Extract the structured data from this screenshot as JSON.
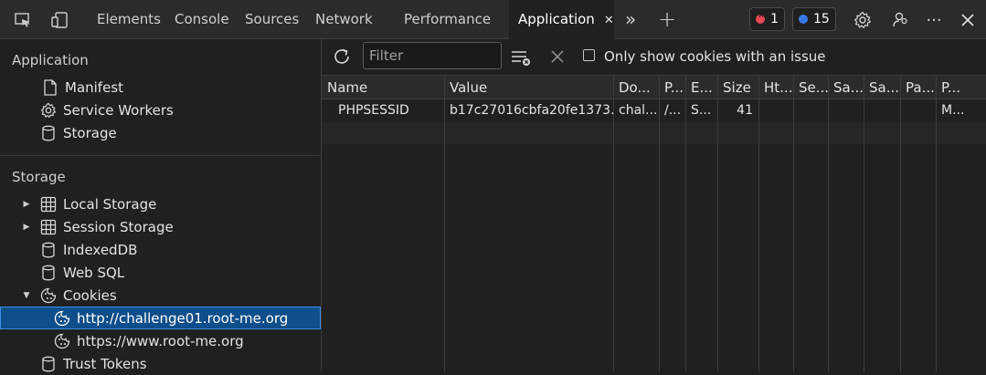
{
  "tabs": {
    "items": [
      "Elements",
      "Console",
      "Sources",
      "Network",
      "Performance"
    ],
    "active": "Application",
    "more": "»",
    "add": "+"
  },
  "badges": {
    "errors": "1",
    "messages": "15"
  },
  "sidebar": {
    "app_section": "Application",
    "app_items": [
      "Manifest",
      "Service Workers",
      "Storage"
    ],
    "storage_section": "Storage",
    "storage_items": [
      "Local Storage",
      "Session Storage",
      "IndexedDB",
      "Web SQL",
      "Cookies"
    ],
    "cookie_items": [
      "http://challenge01.root-me.org",
      "https://www.root-me.org"
    ],
    "trust_tokens": "Trust Tokens"
  },
  "toolbar": {
    "filter_placeholder": "Filter",
    "only_issues_label": "Only show cookies with an issue"
  },
  "table": {
    "columns": [
      "Name",
      "Value",
      "Do...",
      "P...",
      "E...",
      "Size",
      "Ht...",
      "Se...",
      "Sa...",
      "Sa...",
      "Pa...",
      "P..."
    ],
    "rows": [
      [
        "PHPSESSID",
        "b17c27016cbfa20fe1373...",
        "chal...",
        "/...",
        "S...",
        "41",
        "",
        "",
        "",
        "",
        "",
        "M..."
      ]
    ]
  }
}
